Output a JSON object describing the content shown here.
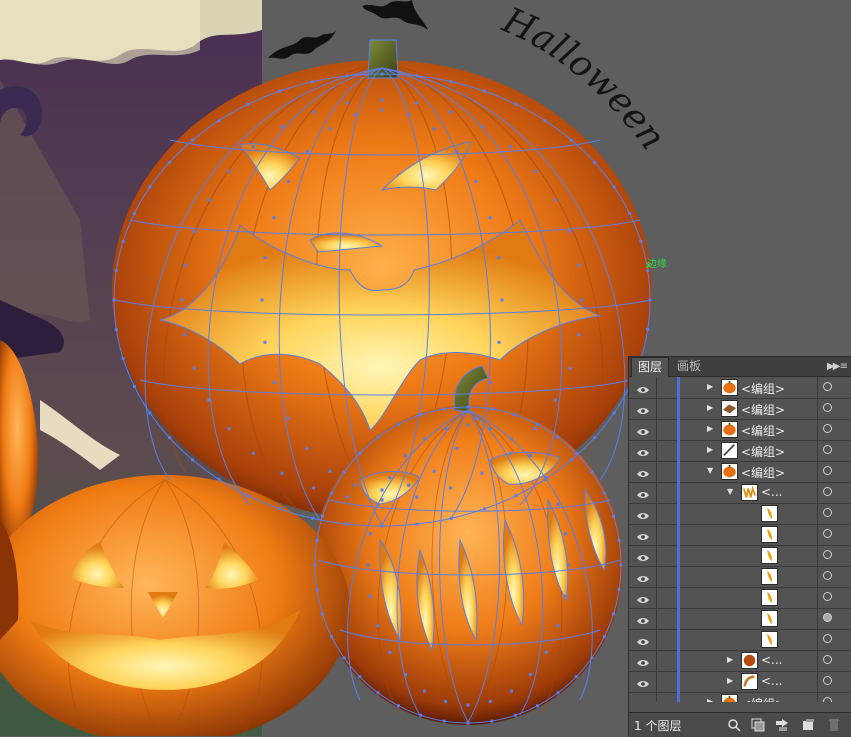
{
  "artboard": {
    "title_text": "Halloween",
    "anchor_label": "边缘"
  },
  "layers_panel": {
    "tabs": [
      {
        "label": "图层",
        "active": true
      },
      {
        "label": "画板",
        "active": false
      }
    ],
    "menu_icon": "panel-menu-arrows",
    "rows": [
      {
        "name": "<编组>",
        "depth": 0,
        "expanded": false,
        "thumb": "pumpkin",
        "target_filled": false
      },
      {
        "name": "<编组>",
        "depth": 0,
        "expanded": false,
        "thumb": "brown",
        "target_filled": false
      },
      {
        "name": "<编组>",
        "depth": 0,
        "expanded": false,
        "thumb": "pumpkin",
        "target_filled": false
      },
      {
        "name": "<编组>",
        "depth": 0,
        "expanded": false,
        "thumb": "stroke",
        "target_filled": false
      },
      {
        "name": "<编组>",
        "depth": 0,
        "expanded": true,
        "thumb": "pumpkin",
        "target_filled": false
      },
      {
        "name": "<...",
        "depth": 1,
        "expanded": true,
        "thumb": "teeth",
        "target_filled": false
      },
      {
        "name": "",
        "depth": 2,
        "expanded": null,
        "thumb": "tooth",
        "target_filled": false
      },
      {
        "name": "",
        "depth": 2,
        "expanded": null,
        "thumb": "tooth",
        "target_filled": false
      },
      {
        "name": "",
        "depth": 2,
        "expanded": null,
        "thumb": "tooth",
        "target_filled": false
      },
      {
        "name": "",
        "depth": 2,
        "expanded": null,
        "thumb": "tooth",
        "target_filled": false
      },
      {
        "name": "",
        "depth": 2,
        "expanded": null,
        "thumb": "tooth",
        "target_filled": false
      },
      {
        "name": "",
        "depth": 2,
        "expanded": null,
        "thumb": "tooth",
        "target_filled": true
      },
      {
        "name": "",
        "depth": 2,
        "expanded": null,
        "thumb": "tooth",
        "target_filled": false
      },
      {
        "name": "<...",
        "depth": 1,
        "expanded": false,
        "thumb": "ball",
        "target_filled": false
      },
      {
        "name": "<...",
        "depth": 1,
        "expanded": false,
        "thumb": "curve",
        "target_filled": false
      },
      {
        "name": "<编组>",
        "depth": 0,
        "expanded": false,
        "thumb": "pumpkin",
        "target_filled": false
      }
    ],
    "footer": {
      "count_label": "1 个图层",
      "icons": [
        "locate-object-icon",
        "make-clipping-mask-icon",
        "new-sublayer-icon",
        "new-layer-icon",
        "delete-layer-icon"
      ]
    }
  },
  "colors": {
    "canvas_bg": "#5e5e5e",
    "panel_bg": "#535353",
    "path_blue": "#5a7ee8",
    "pumpkin_orange": "#e8700f",
    "glow_yellow": "#ffe27a",
    "anchor_green": "#34d94a"
  }
}
